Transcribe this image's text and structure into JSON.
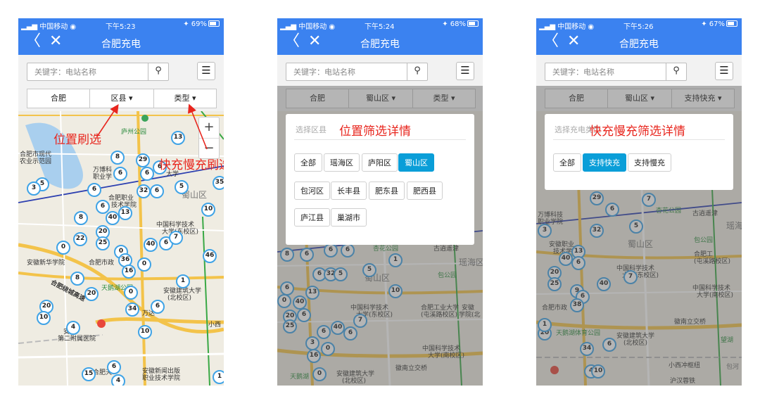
{
  "colors": {
    "nav": "#3b82f0",
    "cluster_border": "#3fa3e6",
    "active_chip": "#0a9ed8",
    "annotation": "#e8261e"
  },
  "phones": [
    {
      "carrier": "中国移动",
      "time": "下午5:23",
      "battery": "69%",
      "title": "合肥充电",
      "search_placeholder": "关键字：电站名称",
      "filters": [
        "合肥",
        "区县 ▾",
        "类型 ▾"
      ]
    },
    {
      "carrier": "中国移动",
      "time": "下午5:24",
      "battery": "68%",
      "title": "合肥充电",
      "search_placeholder": "关键字：电站名称",
      "filters": [
        "合肥",
        "蜀山区 ▾",
        "类型 ▾"
      ],
      "dropdown": {
        "header": "选择区县",
        "options": [
          "全部",
          "瑶海区",
          "庐阳区",
          "蜀山区",
          "包河区",
          "长丰县",
          "肥东县",
          "肥西县",
          "庐江县",
          "巢湖市"
        ],
        "selected": "蜀山区"
      }
    },
    {
      "carrier": "中国移动",
      "time": "下午5:26",
      "battery": "67%",
      "title": "合肥充电",
      "search_placeholder": "关键字：电站名称",
      "filters": [
        "合肥",
        "蜀山区 ▾",
        "支持快充 ▾"
      ],
      "dropdown": {
        "header": "选择充电类型",
        "options": [
          "全部",
          "支持快充",
          "支持慢充"
        ],
        "selected": "支持快充"
      }
    }
  ],
  "annotations": {
    "location_filter": "位置刷选",
    "charge_filter": "快充慢充刷选",
    "location_detail": "位置筛选详情",
    "charge_detail": "快充慢充筛选详情"
  },
  "map_labels": {
    "p1": [
      "庐州公园",
      "合肥市现代",
      "农业示范园",
      "万博科",
      "职业学",
      "合肥职业",
      "技术学院",
      "大学",
      "蜀山区",
      "中国科学技术",
      "大学(东校区)",
      "安徽新华学院",
      "合肥市政",
      "天鹅湖公园",
      "合肥绕城高速",
      "安徽建筑大学",
      "(北校区)",
      "万达",
      "安徽",
      "第二附属医院",
      "小西",
      "合肥天",
      "安徽新闻出版",
      "职业技术学院"
    ],
    "p2": [
      "杏花公园",
      "古逍遥津",
      "瑶海区",
      "包公园",
      "蜀山区",
      "中国科学技术",
      "大学(东校区)",
      "合肥工业大学",
      "(屯溪路校区)",
      "安徽",
      "学院(北",
      "中国科学技术",
      "大学(南校区)",
      "徽南立交桥",
      "安徽建筑大学",
      "(北校区)",
      "天鹅湖"
    ],
    "p3": [
      "杏花公园",
      "古逍遥津",
      "瑶海",
      "万博科技",
      "职业学院",
      "包公园",
      "安徽职业",
      "技术学院",
      "蜀山区",
      "合肥工",
      "(屯溪路校区)",
      "中国科学技术",
      "大学(东校区)",
      "中国科学技术",
      "大学(南校区)",
      "合肥市政",
      "天鹅湖体育公园",
      "安徽建筑大学",
      "(北校区)",
      "徽南立交桥",
      "望湖",
      "小西冲枢纽",
      "包河",
      "沪汉蓉铁"
    ]
  },
  "clusters": {
    "p1": [
      13,
      8,
      29,
      6,
      5,
      6,
      6,
      3,
      6,
      32,
      6,
      5,
      35,
      6,
      40,
      13,
      8,
      10,
      20,
      25,
      22,
      6,
      7,
      40,
      0,
      0,
      36,
      16,
      46,
      0,
      8,
      20,
      0,
      20,
      10,
      34,
      1,
      6,
      4,
      10,
      6,
      15,
      4,
      1
    ],
    "p2": [
      6,
      6,
      5,
      8,
      6,
      6,
      32,
      5,
      6,
      13,
      0,
      7,
      40,
      20,
      6,
      25,
      6,
      10,
      40,
      6,
      3,
      16,
      0,
      0,
      1
    ],
    "p3": [
      29,
      7,
      6,
      32,
      5,
      13,
      3,
      40,
      20,
      25,
      40,
      6,
      9,
      6,
      38,
      20,
      34,
      6,
      4,
      10,
      7,
      1
    ]
  }
}
